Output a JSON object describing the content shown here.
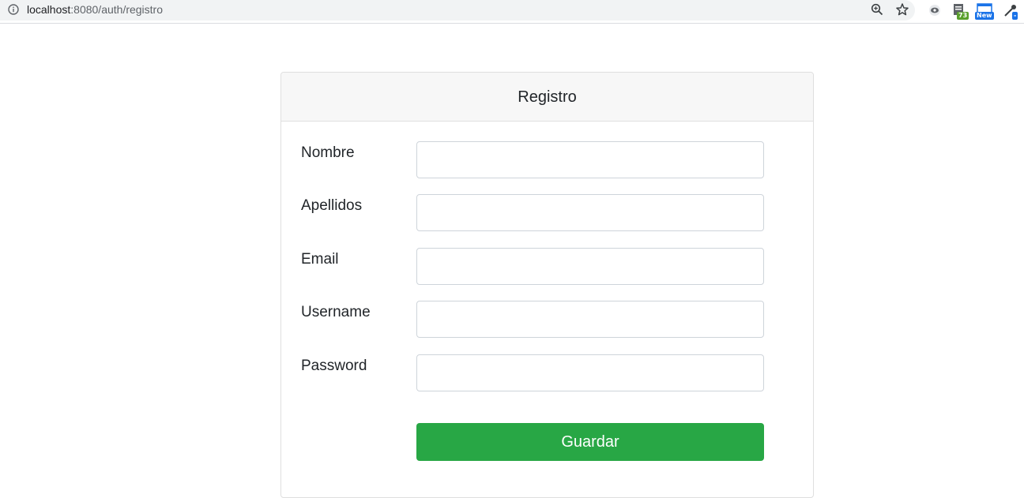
{
  "browser": {
    "url_host": "localhost",
    "url_rest": ":8080/auth/registro",
    "icons": {
      "info": "info-icon",
      "zoom": "zoom-icon",
      "bookmark": "star-icon"
    },
    "extensions": [
      {
        "name": "eye-extension-icon",
        "badge": ""
      },
      {
        "name": "sheet-extension-icon",
        "badge": "73"
      },
      {
        "name": "window-extension-icon",
        "badge": "New"
      },
      {
        "name": "dropper-extension-icon",
        "badge": "-"
      }
    ]
  },
  "form": {
    "title": "Registro",
    "fields": [
      {
        "label": "Nombre",
        "value": "",
        "placeholder": ""
      },
      {
        "label": "Apellidos",
        "value": "",
        "placeholder": ""
      },
      {
        "label": "Email",
        "value": "",
        "placeholder": ""
      },
      {
        "label": "Username",
        "value": "",
        "placeholder": ""
      },
      {
        "label": "Password",
        "value": "",
        "placeholder": ""
      }
    ],
    "submit_label": "Guardar"
  },
  "colors": {
    "submit_button": "#28a745",
    "header_bg": "#f7f7f7"
  }
}
